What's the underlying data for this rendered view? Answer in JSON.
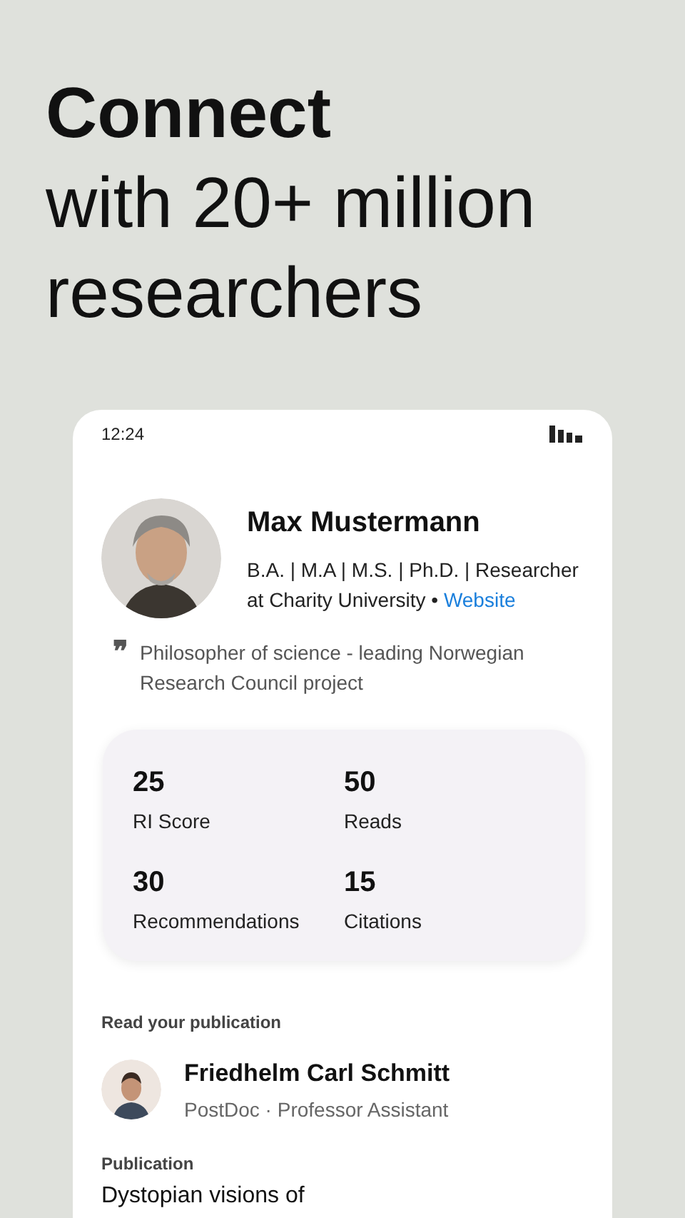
{
  "headline": {
    "title": "Connect",
    "subtitle": "with 20+ million researchers"
  },
  "status_bar": {
    "time": "12:24"
  },
  "profile": {
    "name": "Max Mustermann",
    "details": "B.A. | M.A | M.S. | Ph.D. | Researcher at Charity University •",
    "link": "Website",
    "quote_mark": "❞",
    "quote": "Philosopher of science - leading Norwegian Research Council project"
  },
  "stats": [
    {
      "value": "25",
      "label": "RI Score"
    },
    {
      "value": "50",
      "label": "Reads"
    },
    {
      "value": "30",
      "label": "Recommendations"
    },
    {
      "value": "15",
      "label": "Citations"
    }
  ],
  "read_section": {
    "heading": "Read your publication",
    "author": "Friedhelm Carl Schmitt",
    "role": "PostDoc · Professor Assistant"
  },
  "publication": {
    "heading": "Publication",
    "title": "Dystopian visions of"
  }
}
